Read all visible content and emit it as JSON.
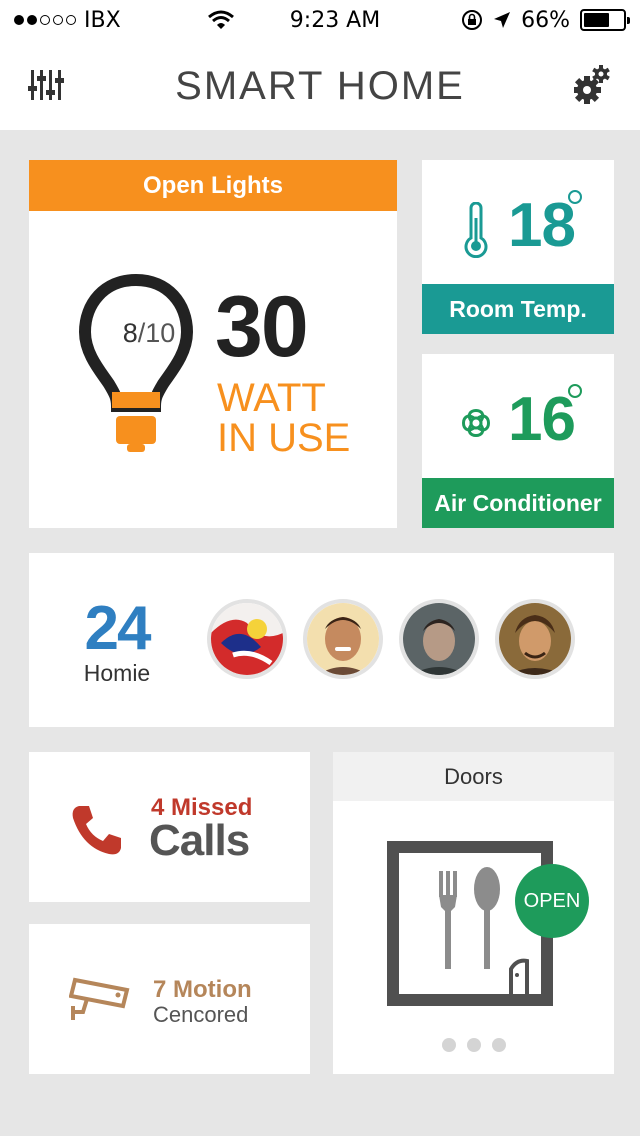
{
  "status_bar": {
    "carrier": "IBX",
    "time": "9:23 AM",
    "battery": "66%",
    "battery_level": 0.66
  },
  "header": {
    "title": "SMART HOME"
  },
  "lights": {
    "title": "Open Lights",
    "ratio_num": "8",
    "ratio_den": "/10",
    "watt_value": "30",
    "watt_line1": "WATT",
    "watt_line2": "IN USE",
    "accent": "#f7901e"
  },
  "room_temp": {
    "value": "18",
    "label": "Room Temp.",
    "color": "#1a9a94"
  },
  "air_conditioner": {
    "value": "16",
    "label": "Air Conditioner",
    "color": "#1e9b5b"
  },
  "homie": {
    "count": "24",
    "label": "Homie",
    "avatars": [
      "avatar-1",
      "avatar-2",
      "avatar-3",
      "avatar-4"
    ]
  },
  "calls": {
    "count_text": "4 Missed",
    "label": "Calls",
    "color": "#c0392b"
  },
  "motion": {
    "count_text": "7 Motion",
    "label": "Cencored",
    "color": "#b5865a"
  },
  "doors": {
    "title": "Doors",
    "status": "OPEN",
    "page_count": 3
  }
}
